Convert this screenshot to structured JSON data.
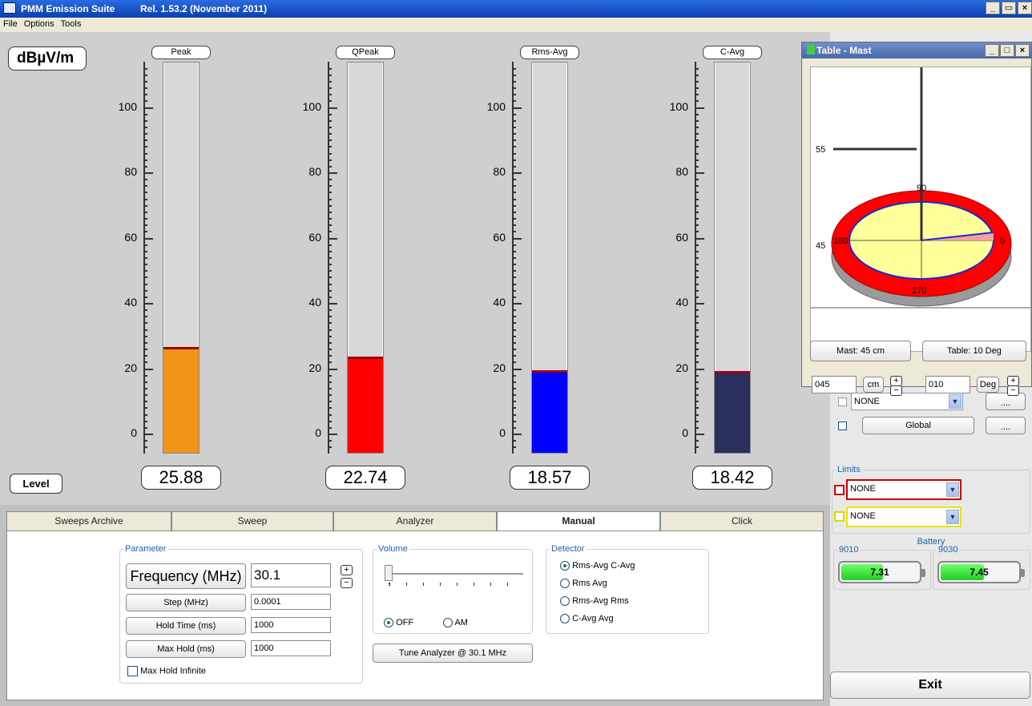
{
  "window": {
    "title": "PMM Emission Suite",
    "release": "Rel. 1.53.2 (November 2011)"
  },
  "menu": [
    "File",
    "Options",
    "Tools"
  ],
  "unit": "dBµV/m",
  "level_button": "Level",
  "scale_labels": [
    "100",
    "80",
    "60",
    "40",
    "20",
    "0"
  ],
  "detectors": [
    {
      "name": "Peak",
      "value": "25.88",
      "level": 25.88,
      "color": "#f39419"
    },
    {
      "name": "QPeak",
      "value": "22.74",
      "level": 22.74,
      "color": "#ff0000"
    },
    {
      "name": "Rms-Avg",
      "value": "18.57",
      "level": 18.57,
      "color": "#0000ff"
    },
    {
      "name": "C-Avg",
      "value": "18.42",
      "level": 18.42,
      "color": "#2b2f5e"
    }
  ],
  "tabs": [
    "Sweeps Archive",
    "Sweep",
    "Analyzer",
    "Manual",
    "Click"
  ],
  "active_tab": "Manual",
  "parameter": {
    "legend": "Parameter",
    "frequency_label": "Frequency (MHz)",
    "frequency_value": "30.1",
    "step_label": "Step (MHz)",
    "step_value": "0.0001",
    "hold_label": "Hold Time (ms)",
    "hold_value": "1000",
    "maxhold_label": "Max Hold (ms)",
    "maxhold_value": "1000",
    "maxhold_infinite": "Max Hold Infinite"
  },
  "volume": {
    "legend": "Volume",
    "off": "OFF",
    "am": "AM",
    "selected": "OFF"
  },
  "tune_button": "Tune Analyzer @ 30.1 MHz",
  "detector_group": {
    "legend": "Detector",
    "options": [
      "Rms-Avg  C-Avg",
      "Rms  Avg",
      "Rms-Avg  Rms",
      "C-Avg  Avg"
    ],
    "selected": 0
  },
  "right": {
    "combo_none_1": "NONE",
    "global_button": "Global",
    "dots": "....",
    "limits_legend": "Limits",
    "limit_1": "NONE",
    "limit_2": "NONE",
    "battery_legend": "Battery",
    "battery_1_name": "9010",
    "battery_1_value": "7.31",
    "battery_2_name": "9030",
    "battery_2_value": "7.45",
    "exit": "Exit"
  },
  "table_mast": {
    "title": "Table - Mast",
    "mast_button": "Mast: 45 cm",
    "table_button": "Table: 10 Deg",
    "mast_value": "045",
    "mast_unit": "cm",
    "table_value": "010",
    "table_unit": "Deg",
    "label_55": "55",
    "label_45": "45",
    "angle_90": "90",
    "angle_180": "180",
    "angle_0": "0",
    "angle_270": "270"
  }
}
